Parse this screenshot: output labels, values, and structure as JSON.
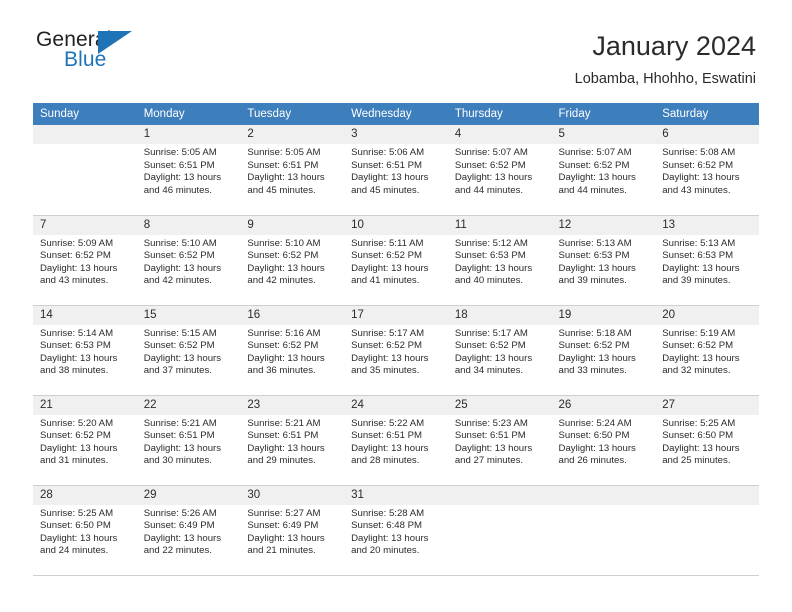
{
  "brand": {
    "name_part1": "General",
    "name_part2": "Blue",
    "logo_icon": "triangle-flag-icon"
  },
  "header": {
    "title": "January 2024",
    "subtitle": "Lobamba, Hhohho, Eswatini"
  },
  "colors": {
    "header_row_bg": "#3d7ebd",
    "brand_blue": "#1f73b7",
    "daynum_bg": "#f0f0f0",
    "grid_line": "#cfcfcf",
    "text": "#2b2b2b"
  },
  "weekday_headers": [
    "Sunday",
    "Monday",
    "Tuesday",
    "Wednesday",
    "Thursday",
    "Friday",
    "Saturday"
  ],
  "weeks": [
    [
      {
        "day": "",
        "blank": true,
        "sunrise": "",
        "sunset": "",
        "daylight_line1": "",
        "daylight_line2": ""
      },
      {
        "day": "1",
        "sunrise": "Sunrise: 5:05 AM",
        "sunset": "Sunset: 6:51 PM",
        "daylight_line1": "Daylight: 13 hours",
        "daylight_line2": "and 46 minutes."
      },
      {
        "day": "2",
        "sunrise": "Sunrise: 5:05 AM",
        "sunset": "Sunset: 6:51 PM",
        "daylight_line1": "Daylight: 13 hours",
        "daylight_line2": "and 45 minutes."
      },
      {
        "day": "3",
        "sunrise": "Sunrise: 5:06 AM",
        "sunset": "Sunset: 6:51 PM",
        "daylight_line1": "Daylight: 13 hours",
        "daylight_line2": "and 45 minutes."
      },
      {
        "day": "4",
        "sunrise": "Sunrise: 5:07 AM",
        "sunset": "Sunset: 6:52 PM",
        "daylight_line1": "Daylight: 13 hours",
        "daylight_line2": "and 44 minutes."
      },
      {
        "day": "5",
        "sunrise": "Sunrise: 5:07 AM",
        "sunset": "Sunset: 6:52 PM",
        "daylight_line1": "Daylight: 13 hours",
        "daylight_line2": "and 44 minutes."
      },
      {
        "day": "6",
        "sunrise": "Sunrise: 5:08 AM",
        "sunset": "Sunset: 6:52 PM",
        "daylight_line1": "Daylight: 13 hours",
        "daylight_line2": "and 43 minutes."
      }
    ],
    [
      {
        "day": "7",
        "sunrise": "Sunrise: 5:09 AM",
        "sunset": "Sunset: 6:52 PM",
        "daylight_line1": "Daylight: 13 hours",
        "daylight_line2": "and 43 minutes."
      },
      {
        "day": "8",
        "sunrise": "Sunrise: 5:10 AM",
        "sunset": "Sunset: 6:52 PM",
        "daylight_line1": "Daylight: 13 hours",
        "daylight_line2": "and 42 minutes."
      },
      {
        "day": "9",
        "sunrise": "Sunrise: 5:10 AM",
        "sunset": "Sunset: 6:52 PM",
        "daylight_line1": "Daylight: 13 hours",
        "daylight_line2": "and 42 minutes."
      },
      {
        "day": "10",
        "sunrise": "Sunrise: 5:11 AM",
        "sunset": "Sunset: 6:52 PM",
        "daylight_line1": "Daylight: 13 hours",
        "daylight_line2": "and 41 minutes."
      },
      {
        "day": "11",
        "sunrise": "Sunrise: 5:12 AM",
        "sunset": "Sunset: 6:53 PM",
        "daylight_line1": "Daylight: 13 hours",
        "daylight_line2": "and 40 minutes."
      },
      {
        "day": "12",
        "sunrise": "Sunrise: 5:13 AM",
        "sunset": "Sunset: 6:53 PM",
        "daylight_line1": "Daylight: 13 hours",
        "daylight_line2": "and 39 minutes."
      },
      {
        "day": "13",
        "sunrise": "Sunrise: 5:13 AM",
        "sunset": "Sunset: 6:53 PM",
        "daylight_line1": "Daylight: 13 hours",
        "daylight_line2": "and 39 minutes."
      }
    ],
    [
      {
        "day": "14",
        "sunrise": "Sunrise: 5:14 AM",
        "sunset": "Sunset: 6:53 PM",
        "daylight_line1": "Daylight: 13 hours",
        "daylight_line2": "and 38 minutes."
      },
      {
        "day": "15",
        "sunrise": "Sunrise: 5:15 AM",
        "sunset": "Sunset: 6:52 PM",
        "daylight_line1": "Daylight: 13 hours",
        "daylight_line2": "and 37 minutes."
      },
      {
        "day": "16",
        "sunrise": "Sunrise: 5:16 AM",
        "sunset": "Sunset: 6:52 PM",
        "daylight_line1": "Daylight: 13 hours",
        "daylight_line2": "and 36 minutes."
      },
      {
        "day": "17",
        "sunrise": "Sunrise: 5:17 AM",
        "sunset": "Sunset: 6:52 PM",
        "daylight_line1": "Daylight: 13 hours",
        "daylight_line2": "and 35 minutes."
      },
      {
        "day": "18",
        "sunrise": "Sunrise: 5:17 AM",
        "sunset": "Sunset: 6:52 PM",
        "daylight_line1": "Daylight: 13 hours",
        "daylight_line2": "and 34 minutes."
      },
      {
        "day": "19",
        "sunrise": "Sunrise: 5:18 AM",
        "sunset": "Sunset: 6:52 PM",
        "daylight_line1": "Daylight: 13 hours",
        "daylight_line2": "and 33 minutes."
      },
      {
        "day": "20",
        "sunrise": "Sunrise: 5:19 AM",
        "sunset": "Sunset: 6:52 PM",
        "daylight_line1": "Daylight: 13 hours",
        "daylight_line2": "and 32 minutes."
      }
    ],
    [
      {
        "day": "21",
        "sunrise": "Sunrise: 5:20 AM",
        "sunset": "Sunset: 6:52 PM",
        "daylight_line1": "Daylight: 13 hours",
        "daylight_line2": "and 31 minutes."
      },
      {
        "day": "22",
        "sunrise": "Sunrise: 5:21 AM",
        "sunset": "Sunset: 6:51 PM",
        "daylight_line1": "Daylight: 13 hours",
        "daylight_line2": "and 30 minutes."
      },
      {
        "day": "23",
        "sunrise": "Sunrise: 5:21 AM",
        "sunset": "Sunset: 6:51 PM",
        "daylight_line1": "Daylight: 13 hours",
        "daylight_line2": "and 29 minutes."
      },
      {
        "day": "24",
        "sunrise": "Sunrise: 5:22 AM",
        "sunset": "Sunset: 6:51 PM",
        "daylight_line1": "Daylight: 13 hours",
        "daylight_line2": "and 28 minutes."
      },
      {
        "day": "25",
        "sunrise": "Sunrise: 5:23 AM",
        "sunset": "Sunset: 6:51 PM",
        "daylight_line1": "Daylight: 13 hours",
        "daylight_line2": "and 27 minutes."
      },
      {
        "day": "26",
        "sunrise": "Sunrise: 5:24 AM",
        "sunset": "Sunset: 6:50 PM",
        "daylight_line1": "Daylight: 13 hours",
        "daylight_line2": "and 26 minutes."
      },
      {
        "day": "27",
        "sunrise": "Sunrise: 5:25 AM",
        "sunset": "Sunset: 6:50 PM",
        "daylight_line1": "Daylight: 13 hours",
        "daylight_line2": "and 25 minutes."
      }
    ],
    [
      {
        "day": "28",
        "sunrise": "Sunrise: 5:25 AM",
        "sunset": "Sunset: 6:50 PM",
        "daylight_line1": "Daylight: 13 hours",
        "daylight_line2": "and 24 minutes."
      },
      {
        "day": "29",
        "sunrise": "Sunrise: 5:26 AM",
        "sunset": "Sunset: 6:49 PM",
        "daylight_line1": "Daylight: 13 hours",
        "daylight_line2": "and 22 minutes."
      },
      {
        "day": "30",
        "sunrise": "Sunrise: 5:27 AM",
        "sunset": "Sunset: 6:49 PM",
        "daylight_line1": "Daylight: 13 hours",
        "daylight_line2": "and 21 minutes."
      },
      {
        "day": "31",
        "sunrise": "Sunrise: 5:28 AM",
        "sunset": "Sunset: 6:48 PM",
        "daylight_line1": "Daylight: 13 hours",
        "daylight_line2": "and 20 minutes."
      },
      {
        "day": "",
        "blank": true,
        "sunrise": "",
        "sunset": "",
        "daylight_line1": "",
        "daylight_line2": ""
      },
      {
        "day": "",
        "blank": true,
        "sunrise": "",
        "sunset": "",
        "daylight_line1": "",
        "daylight_line2": ""
      },
      {
        "day": "",
        "blank": true,
        "sunrise": "",
        "sunset": "",
        "daylight_line1": "",
        "daylight_line2": ""
      }
    ]
  ]
}
